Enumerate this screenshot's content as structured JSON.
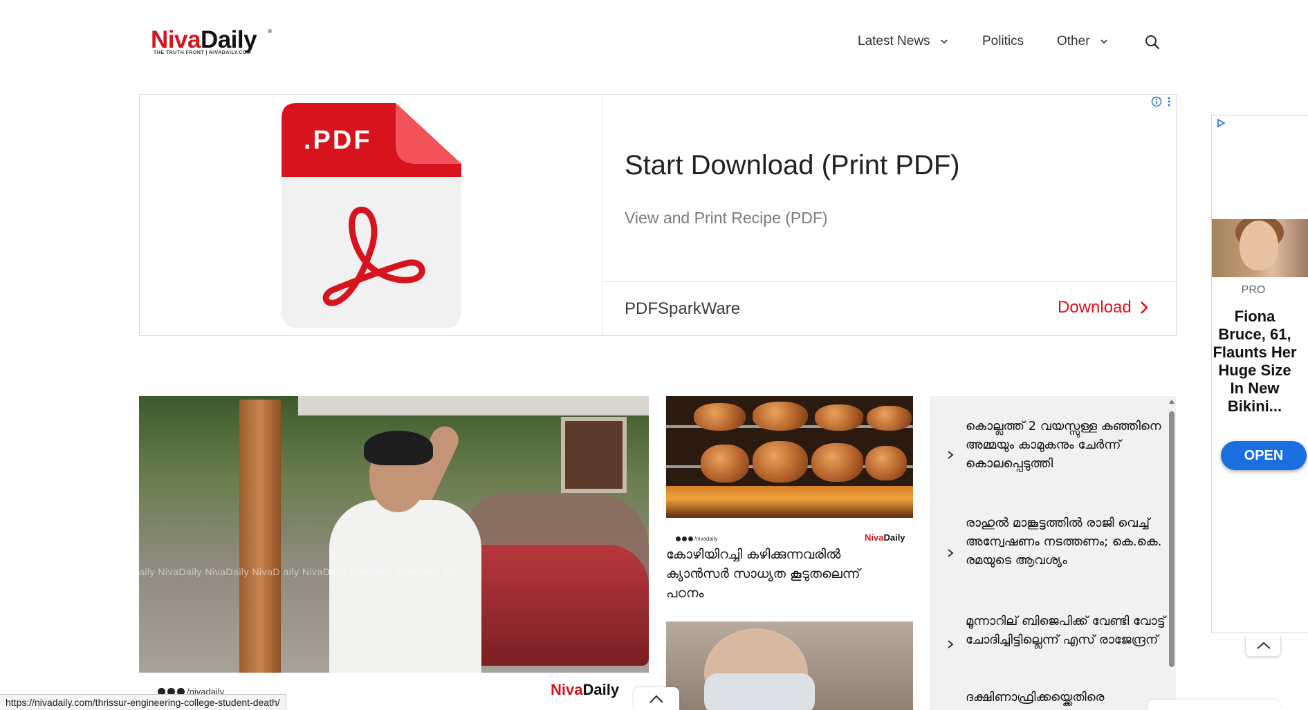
{
  "header": {
    "logo": {
      "part1": "Niva",
      "part2": "Daily",
      "tagline": "THE TRUTH FRONT | NIVADAILY.COM",
      "reg": "®"
    },
    "nav": [
      {
        "label": "Latest News",
        "has_dropdown": true
      },
      {
        "label": "Politics",
        "has_dropdown": false
      },
      {
        "label": "Other",
        "has_dropdown": true
      }
    ],
    "search_icon": "search-icon"
  },
  "ad_banner": {
    "file_label": ".PDF",
    "title": "Start Download (Print PDF)",
    "description": "View and Print Recipe (PDF)",
    "advertiser": "PDFSparkWare",
    "cta": "Download",
    "colors": {
      "cta": "#e5101b",
      "pdf_red": "#d7141e"
    }
  },
  "side_ad": {
    "label": "PRO",
    "headline": "Fiona Bruce, 61, Flaunts Her Huge Size In New Bikini...",
    "button": "OPEN",
    "button_color": "#1a6fe0"
  },
  "feature": {
    "watermark": "aily  NivaDaily  NivaDaily  NivaD         aily  NivaDaily  NivaDaily  NivaDaily  Niv",
    "meta_handle": "/nivadaily",
    "logo_part1": "Niva",
    "logo_part2": "Daily"
  },
  "middle": {
    "meta_handle": "/nivadaily",
    "logo_part1": "Niva",
    "logo_part2": "Daily",
    "title": "കോഴിയിറച്ചി കഴിക്കുന്നവരിൽ ക്യാൻസർ സാധ്യത കൂടുതലെന്ന് പഠനം"
  },
  "list": [
    "കൊല്ലത്ത് 2 വയസ്സുള്ള കുഞ്ഞിനെ അമ്മയും കാമുകനും ചേർന്ന് കൊലപ്പെടുത്തി",
    "രാഹുൽ മാങ്കൂട്ടത്തിൽ രാജി വെച്ച് അന്വേഷണം നടത്തണം; കെ.കെ. രമയുടെ ആവശ്യം",
    "മൂന്നാറില് ബിജെപിക്ക് വേണ്ടി വോട്ട് ചോദിച്ചിട്ടില്ലെന്ന് എസ് രാജേന്ദ്രന്",
    "ദക്ഷിണാഫ്രിക്കയ്ക്കെതിരെ"
  ],
  "status_bar": {
    "url": "https://nivadaily.com/thrissur-engineering-college-student-death/"
  }
}
